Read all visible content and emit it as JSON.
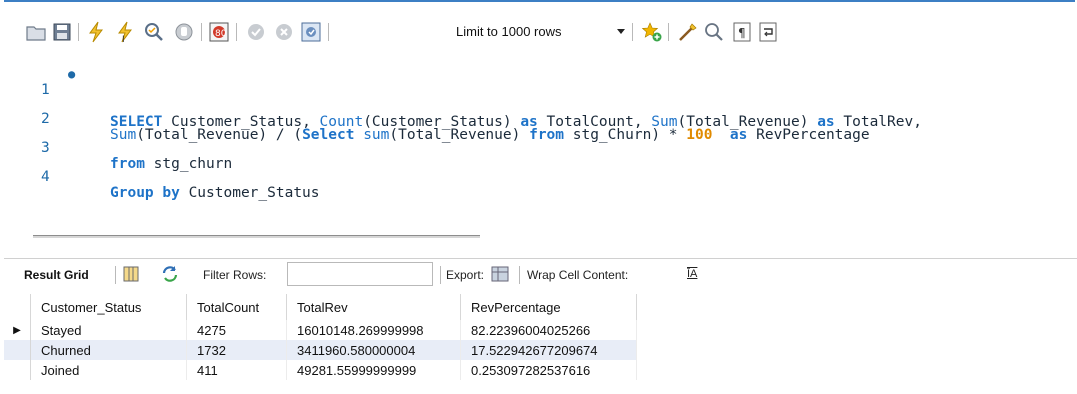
{
  "toolbar": {
    "limit_label": "Limit to 1000 rows",
    "icons": [
      "folder-open-icon",
      "save-icon",
      "execute-icon",
      "execute-current-icon",
      "explain-icon",
      "stop-icon",
      "toggle-error-icon",
      "commit-icon",
      "rollback-icon",
      "autocommit-icon",
      "add-snippet-icon",
      "beautify-icon",
      "find-icon",
      "invisible-chars-icon",
      "wrap-icon"
    ]
  },
  "editor": {
    "lines": [
      {
        "number": "1",
        "marker": "●"
      },
      {
        "number": "2"
      },
      {
        "number": "3"
      },
      {
        "number": "4"
      }
    ],
    "tokens": {
      "l1": [
        "SELECT",
        " Customer_Status, ",
        "Count",
        "(Customer_Status) ",
        "as",
        " TotalCount, ",
        "Sum",
        "(Total_Revenue) ",
        "as",
        " TotalRev,"
      ],
      "l2": [
        "Sum",
        "(Total_Revenue) / (",
        "Select",
        " ",
        "sum",
        "(Total_Revenue) ",
        "from",
        " stg_Churn) * ",
        "100",
        "  ",
        "as",
        " RevPercentage"
      ],
      "l3": [
        "from",
        " stg_churn"
      ],
      "l4": [
        "Group by",
        " Customer_Status"
      ]
    }
  },
  "result_toolbar": {
    "result_grid": "Result Grid",
    "filter_rows": "Filter Rows:",
    "export": "Export:",
    "wrap_cell": "Wrap Cell Content:",
    "wrap_glyph": "ĪA"
  },
  "grid": {
    "columns": [
      "Customer_Status",
      "TotalCount",
      "TotalRev",
      "RevPercentage"
    ],
    "rows": [
      [
        "Stayed",
        "4275",
        "16010148.269999998",
        "82.22396004025266"
      ],
      [
        "Churned",
        "1732",
        "3411960.580000004",
        "17.522942677209674"
      ],
      [
        "Joined",
        "411",
        "49281.55999999999",
        "0.253097282537616"
      ]
    ],
    "current_row_marker": "▶"
  },
  "colors": {
    "accent": "#3c7fc4",
    "keyword": "#1e73c8",
    "number": "#e08a00",
    "row_alt": "#e8edf7"
  }
}
